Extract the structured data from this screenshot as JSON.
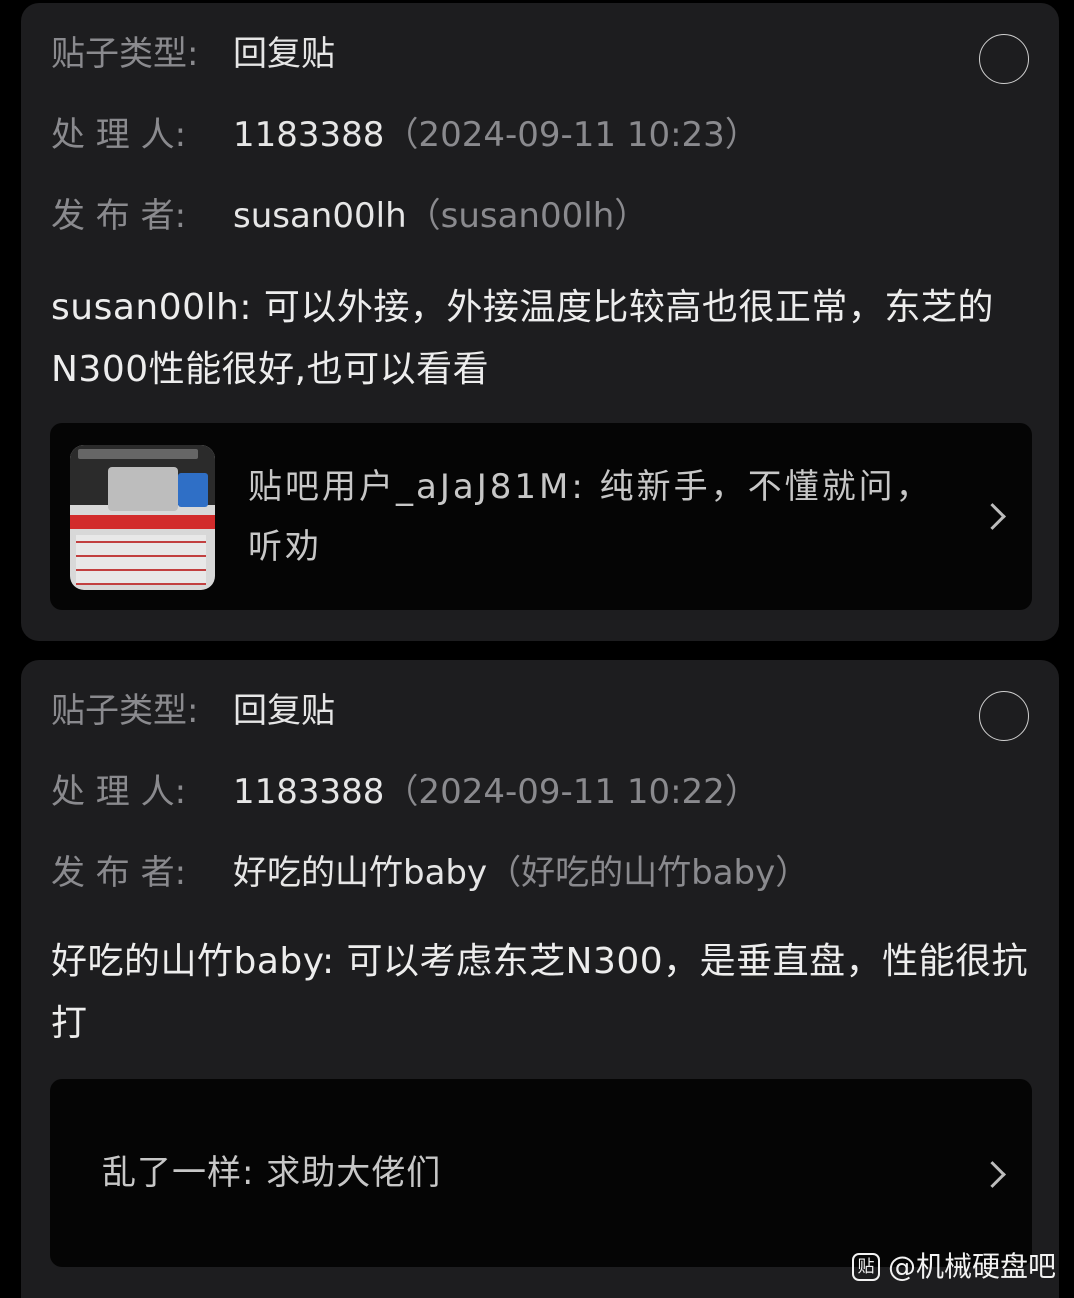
{
  "cards": [
    {
      "post_type_label": "贴子类型:",
      "post_type_value": "回复贴",
      "handler_label": "处 理 人:",
      "handler_value": "1183388",
      "handler_time": "（2024-09-11 10:23）",
      "poster_label": "发 布 者:",
      "poster_value": "susan00lh",
      "poster_sub": "（susan00lh）",
      "content": "susan00lh: 可以外接，外接温度比较高也很正常，东芝的N300性能很好,也可以看看",
      "quote_text": "贴吧用户_aJaJ81M: 纯新手，不懂就问，听劝",
      "quote_has_thumb": true
    },
    {
      "post_type_label": "贴子类型:",
      "post_type_value": "回复贴",
      "handler_label": "处 理 人:",
      "handler_value": "1183388",
      "handler_time": "（2024-09-11 10:22）",
      "poster_label": "发 布 者:",
      "poster_value": "好吃的山竹baby",
      "poster_sub": "（好吃的山竹baby）",
      "content": "好吃的山竹baby: 可以考虑东芝N300，是垂直盘，性能很抗打",
      "quote_text": "乱了一样: 求助大佬们",
      "quote_has_thumb": false
    }
  ],
  "watermark": {
    "icon_glyph": "贴",
    "text": "@机械硬盘吧"
  }
}
